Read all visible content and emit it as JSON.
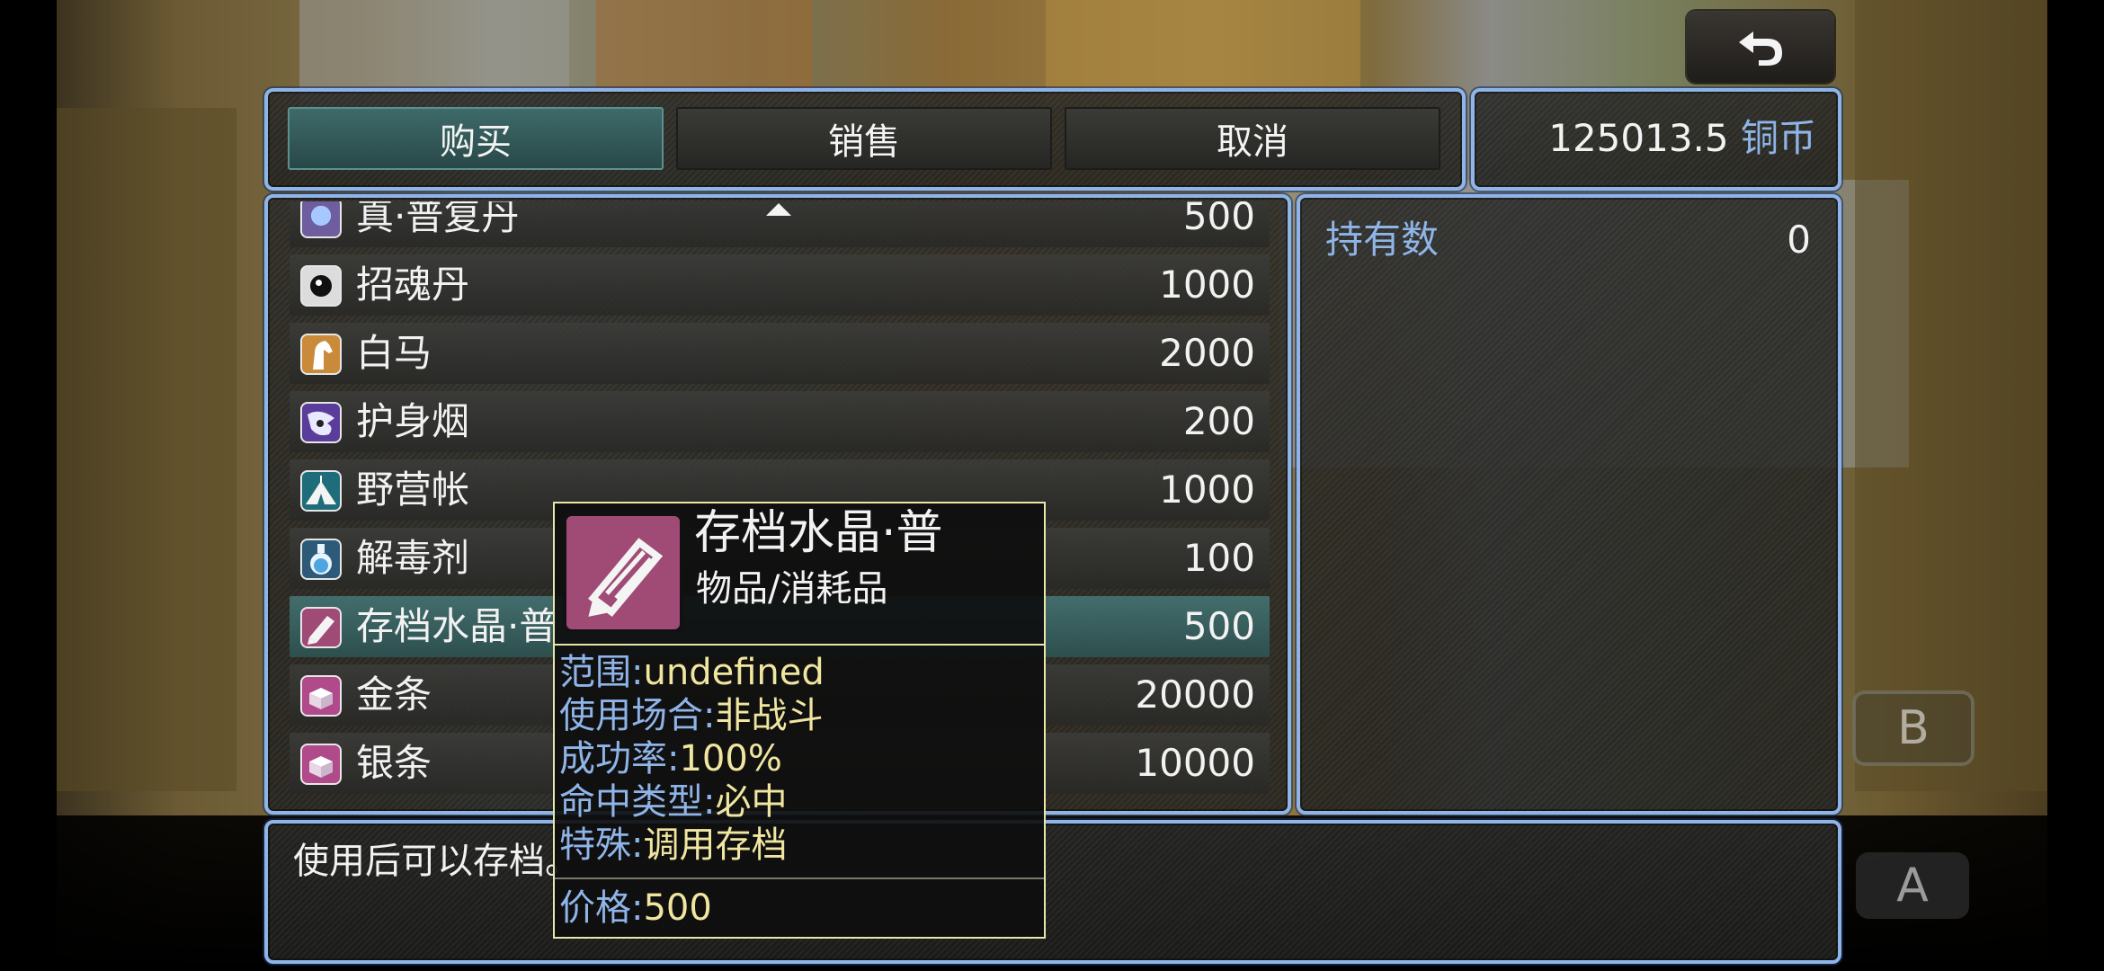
{
  "tabs": [
    "购买",
    "销售",
    "取消"
  ],
  "money": {
    "amount": "125013.5",
    "unit": "铜币"
  },
  "items": [
    {
      "name": "真·普复丹",
      "price": "500",
      "icon": "blue-orb-icon"
    },
    {
      "name": "招魂丹",
      "price": "1000",
      "icon": "black-pill-icon"
    },
    {
      "name": "白马",
      "price": "2000",
      "icon": "horse-icon"
    },
    {
      "name": "护身烟",
      "price": "200",
      "icon": "smoke-icon"
    },
    {
      "name": "野营帐",
      "price": "1000",
      "icon": "tent-icon"
    },
    {
      "name": "解毒剂",
      "price": "100",
      "icon": "flask-icon"
    },
    {
      "name": "存档水晶·普",
      "price": "500",
      "icon": "crystal-icon"
    },
    {
      "name": "金条",
      "price": "20000",
      "icon": "gold-bar-icon"
    },
    {
      "name": "银条",
      "price": "10000",
      "icon": "silver-bar-icon"
    }
  ],
  "status": {
    "owned_label": "持有数",
    "owned_value": "0"
  },
  "description": "使用后可以存档。",
  "tooltip": {
    "name": "存档水晶·普",
    "category": "物品/消耗品",
    "lines": [
      {
        "label": "范围:",
        "value": "undefined"
      },
      {
        "label": "使用场合:",
        "value": "非战斗"
      },
      {
        "label": "成功率:",
        "value": "100%"
      },
      {
        "label": "命中类型:",
        "value": "必中"
      },
      {
        "label": "特殊:",
        "value": "调用存档"
      }
    ],
    "price": {
      "label": "价格:",
      "value": "500"
    }
  },
  "buttons": {
    "b": "B",
    "a": "A"
  },
  "colors": {
    "frame": "#8fb4e8",
    "selected_row": "#467878",
    "accent_text": "#8fb4e8",
    "value_text": "#f0e6a0"
  }
}
